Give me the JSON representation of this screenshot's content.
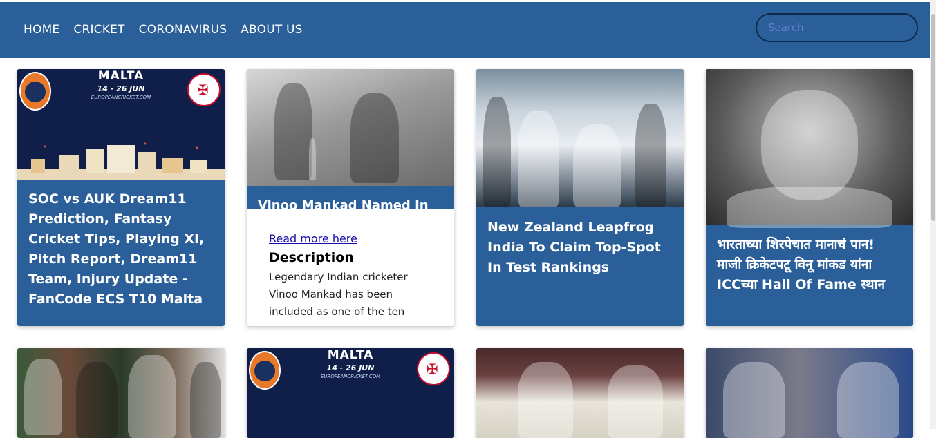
{
  "nav": {
    "links": [
      "HOME",
      "CRICKET",
      "CORONAVIRUS",
      "ABOUT US"
    ],
    "search_placeholder": "Search"
  },
  "cards": [
    {
      "title": "SOC vs AUK Dream11 Prediction, Fantasy Cricket Tips, Playing XI, Pitch Report, Dream11 Team, Injury Update - FanCode ECS T10 Malta",
      "image": "malta-banner"
    },
    {
      "title": "Vinoo Mankad Named In",
      "read_more": "Read more here",
      "description_heading": "Description",
      "description": "Legendary Indian cricketer Vinoo Mankad has been included as one of the ten players in the special edition",
      "image": "vintage-batting-photo"
    },
    {
      "title": "New Zealand Leapfrog India To Claim Top-Spot In Test Rankings",
      "image": "team-trophy-photo"
    },
    {
      "title": "भारताच्या शिरपेचात मानाचं पान! माजी क्रिकेटपटू विनू मांकड यांना ICCच्या Hall Of Fame स्थान",
      "image": "portrait-photo"
    }
  ],
  "malta_banner": {
    "title": "MALTA",
    "dates": "14 - 26 JUN",
    "url": "EUROPEANCRICKET.COM"
  },
  "colors": {
    "nav_bg": "#2b5f99",
    "card_bg": "#2b5f99",
    "link": "#1a0dab"
  }
}
